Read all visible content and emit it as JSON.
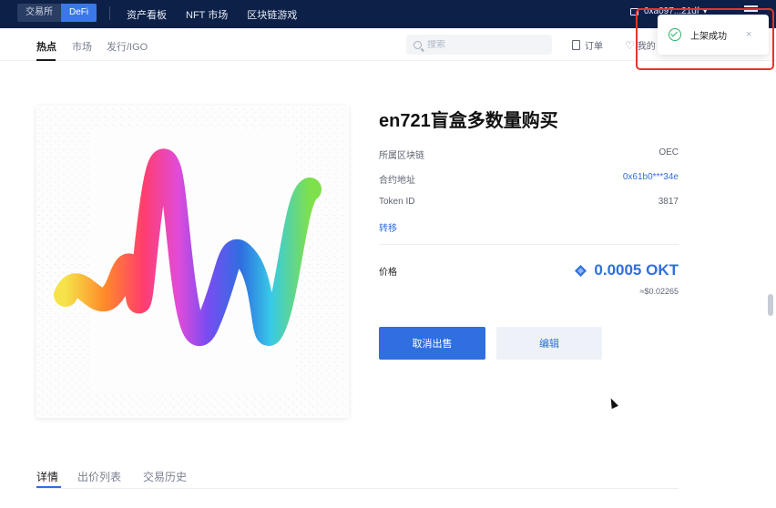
{
  "topbar": {
    "mode_tabs": [
      {
        "label": "交易所",
        "active": false
      },
      {
        "label": "DeFi",
        "active": true
      }
    ],
    "nav": [
      "资产看板",
      "NFT 市场",
      "区块链游戏"
    ],
    "wallet_address": "0xa097...21df",
    "wallet_caret": "▾",
    "menu_icon": "hamburger-icon"
  },
  "subnav": {
    "tabs": [
      "热点",
      "市场",
      "发行/IGO"
    ],
    "active_tab": "热点",
    "search_placeholder": "搜索",
    "orders_label": "订单",
    "mine_label": "我的"
  },
  "toast": {
    "message": "上架成功",
    "close": "×",
    "status_color": "#2cb36a",
    "highlight_color": "#e6352b"
  },
  "nft": {
    "title": "en721盲盒多数量购买",
    "rows": [
      {
        "label": "所属区块链",
        "value": "OEC",
        "link": false
      },
      {
        "label": "合约地址",
        "value": "0x61b0***34e",
        "link": true
      },
      {
        "label": "Token ID",
        "value": "3817",
        "link": false
      }
    ],
    "transfer_label": "转移",
    "price_label": "价格",
    "price": "0.0005 OKT",
    "price_fiat": "≈$0.02265",
    "cancel_button": "取消出售",
    "edit_button": "编辑",
    "accent_color": "#2f6fe0"
  },
  "bottom_tabs": [
    "详情",
    "出价列表",
    "交易历史"
  ],
  "bottom_active_tab": "详情"
}
